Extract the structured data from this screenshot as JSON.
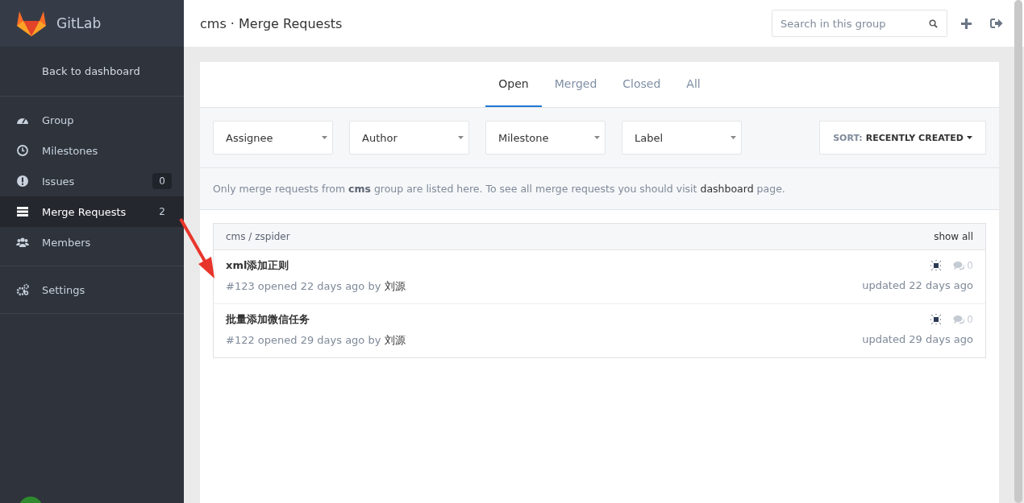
{
  "sidebar": {
    "brand": "GitLab",
    "back_link": "Back to dashboard",
    "items": [
      {
        "label": "Group",
        "selected": false
      },
      {
        "label": "Milestones",
        "selected": false
      },
      {
        "label": "Issues",
        "count": "0",
        "selected": false
      },
      {
        "label": "Merge Requests",
        "count": "2",
        "selected": true
      },
      {
        "label": "Members",
        "selected": false
      }
    ],
    "footer_items": [
      {
        "label": "Settings",
        "selected": false
      }
    ]
  },
  "header": {
    "title": "cms · Merge Requests",
    "search": {
      "placeholder": "Search in this group"
    }
  },
  "tabs": [
    {
      "label": "Open",
      "selected": true
    },
    {
      "label": "Merged",
      "selected": false
    },
    {
      "label": "Closed",
      "selected": false
    },
    {
      "label": "All",
      "selected": false
    }
  ],
  "filters": [
    "Assignee",
    "Author",
    "Milestone",
    "Label"
  ],
  "sort": {
    "prefix": "SORT:",
    "value": "RECENTLY CREATED"
  },
  "notice": {
    "text": "Only merge requests from **cms** group are listed here. To see all merge requests you should visit ",
    "link": "dashboard",
    "after": " page."
  },
  "project": {
    "name": "cms / zspider",
    "show_all": "show all",
    "merge_requests": [
      {
        "title": "xml添加正则",
        "meta": "#123 opened 22 days ago by ",
        "author": "刘源",
        "comments": "0",
        "updated": "updated 22 days ago"
      },
      {
        "title": "批量添加微信任务",
        "meta": "#122 opened 29 days ago by ",
        "author": "刘源",
        "comments": "0",
        "updated": "updated 29 days ago"
      }
    ]
  }
}
